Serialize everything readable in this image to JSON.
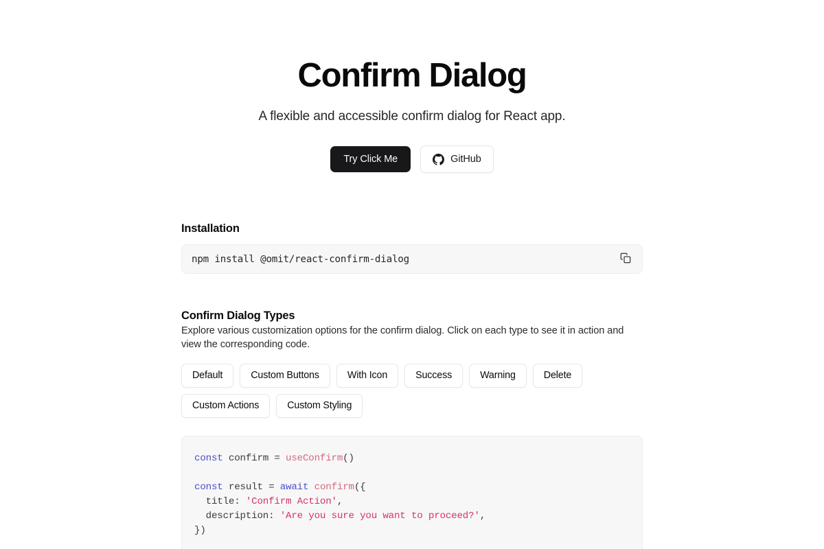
{
  "hero": {
    "title": "Confirm Dialog",
    "subtitle": "A flexible and accessible confirm dialog for React app.",
    "primary_button": "Try Click Me",
    "secondary_button": "GitHub",
    "secondary_icon": "github-icon"
  },
  "installation": {
    "heading": "Installation",
    "command": "npm install @omit/react-confirm-dialog",
    "copy_icon": "copy-icon"
  },
  "types": {
    "heading": "Confirm Dialog Types",
    "description": "Explore various customization options for the confirm dialog. Click on each type to see it in action and view the corresponding code.",
    "rows": [
      [
        "Default",
        "Custom Buttons",
        "With Icon",
        "Success",
        "Warning",
        "Delete"
      ],
      [
        "Custom Actions",
        "Custom Styling"
      ]
    ]
  },
  "code": {
    "lines": [
      [
        {
          "t": "const",
          "c": "tok-kw"
        },
        {
          "t": " confirm = ",
          "c": "tok-pl"
        },
        {
          "t": "useConfirm",
          "c": "tok-fn"
        },
        {
          "t": "()",
          "c": "tok-pl"
        }
      ],
      [],
      [
        {
          "t": "const",
          "c": "tok-kw"
        },
        {
          "t": " result = ",
          "c": "tok-pl"
        },
        {
          "t": "await",
          "c": "tok-kw"
        },
        {
          "t": " ",
          "c": "tok-pl"
        },
        {
          "t": "confirm",
          "c": "tok-fn"
        },
        {
          "t": "({",
          "c": "tok-pl"
        }
      ],
      [
        {
          "t": "  title: ",
          "c": "tok-pl"
        },
        {
          "t": "'Confirm Action'",
          "c": "tok-str"
        },
        {
          "t": ",",
          "c": "tok-pl"
        }
      ],
      [
        {
          "t": "  description: ",
          "c": "tok-pl"
        },
        {
          "t": "'Are you sure you want to proceed?'",
          "c": "tok-str"
        },
        {
          "t": ",",
          "c": "tok-pl"
        }
      ],
      [
        {
          "t": "})",
          "c": "tok-pl"
        }
      ]
    ]
  },
  "colors": {
    "accent_dark": "#18181b",
    "code_bg": "#f7f7f8",
    "keyword": "#4b4fc8",
    "function": "#d4697c",
    "string": "#d6336c",
    "page_bg": "#ffffff"
  }
}
